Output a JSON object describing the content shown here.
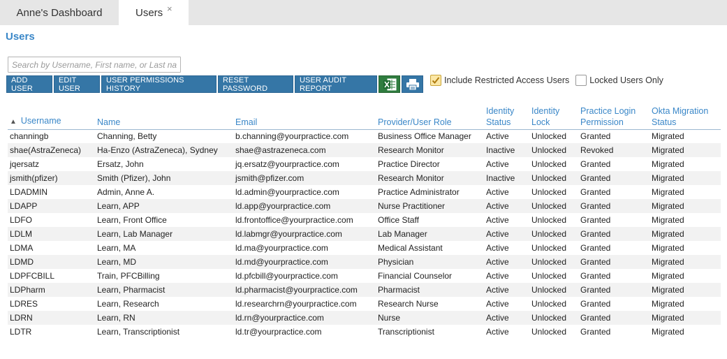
{
  "tabs": [
    {
      "label": "Anne's Dashboard"
    },
    {
      "label": "Users",
      "close": "×"
    }
  ],
  "page": {
    "title": "Users"
  },
  "search": {
    "placeholder": "Search by Username, First name, or Last name"
  },
  "toolbar": {
    "add_user": "ADD USER",
    "edit_user": "EDIT USER",
    "permissions_history": "USER PERMISSIONS HISTORY",
    "reset_password": "RESET PASSWORD",
    "audit_report": "USER AUDIT REPORT"
  },
  "filters": {
    "include_restricted": "Include Restricted Access Users",
    "locked_only": "Locked Users Only"
  },
  "table": {
    "headers": {
      "username": "Username",
      "name": "Name",
      "email": "Email",
      "role": "Provider/User Role",
      "identity_status": "Identity Status",
      "identity_lock": "Identity Lock",
      "login_permission": "Practice Login Permission",
      "okta_status": "Okta Migration Status"
    },
    "rows": [
      [
        "channingb",
        "Channing, Betty",
        "b.channing@yourpractice.com",
        "Business Office Manager",
        "Active",
        "Unlocked",
        "Granted",
        "Migrated"
      ],
      [
        "shae(AstraZeneca)",
        "Ha-Enzo (AstraZeneca), Sydney",
        "shae@astrazeneca.com",
        "Research Monitor",
        "Inactive",
        "Unlocked",
        "Revoked",
        "Migrated"
      ],
      [
        "jqersatz",
        "Ersatz, John",
        "jq.ersatz@yourpractice.com",
        "Practice Director",
        "Active",
        "Unlocked",
        "Granted",
        "Migrated"
      ],
      [
        "jsmith(pfizer)",
        "Smith (Pfizer), John",
        "jsmith@pfizer.com",
        "Research Monitor",
        "Inactive",
        "Unlocked",
        "Granted",
        "Migrated"
      ],
      [
        "LDADMIN",
        "Admin, Anne A.",
        "ld.admin@yourpractice.com",
        "Practice Administrator",
        "Active",
        "Unlocked",
        "Granted",
        "Migrated"
      ],
      [
        "LDAPP",
        "Learn, APP",
        "ld.app@yourpractice.com",
        "Nurse Practitioner",
        "Active",
        "Unlocked",
        "Granted",
        "Migrated"
      ],
      [
        "LDFO",
        "Learn, Front Office",
        "ld.frontoffice@yourpractice.com",
        "Office Staff",
        "Active",
        "Unlocked",
        "Granted",
        "Migrated"
      ],
      [
        "LDLM",
        "Learn, Lab Manager",
        "ld.labmgr@yourpractice.com",
        "Lab Manager",
        "Active",
        "Unlocked",
        "Granted",
        "Migrated"
      ],
      [
        "LDMA",
        "Learn, MA",
        "ld.ma@yourpractice.com",
        "Medical Assistant",
        "Active",
        "Unlocked",
        "Granted",
        "Migrated"
      ],
      [
        "LDMD",
        "Learn, MD",
        "ld.md@yourpractice.com",
        "Physician",
        "Active",
        "Unlocked",
        "Granted",
        "Migrated"
      ],
      [
        "LDPFCBILL",
        "Train, PFCBilling",
        "ld.pfcbill@yourpractice.com",
        "Financial Counselor",
        "Active",
        "Unlocked",
        "Granted",
        "Migrated"
      ],
      [
        "LDPharm",
        "Learn, Pharmacist",
        "ld.pharmacist@yourpractice.com",
        "Pharmacist",
        "Active",
        "Unlocked",
        "Granted",
        "Migrated"
      ],
      [
        "LDRES",
        "Learn, Research",
        "ld.researchrn@yourpractice.com",
        "Research Nurse",
        "Active",
        "Unlocked",
        "Granted",
        "Migrated"
      ],
      [
        "LDRN",
        "Learn, RN",
        "ld.rn@yourpractice.com",
        "Nurse",
        "Active",
        "Unlocked",
        "Granted",
        "Migrated"
      ],
      [
        "LDTR",
        "Learn, Transcriptionist",
        "ld.tr@yourpractice.com",
        "Transcriptionist",
        "Active",
        "Unlocked",
        "Granted",
        "Migrated"
      ]
    ]
  },
  "icons": {
    "excel": "excel-export-icon",
    "print": "printer-icon",
    "sort": "sort-ascending-icon",
    "check": "checkmark-icon"
  },
  "colors": {
    "accent": "#3a87c8",
    "button": "#3576a6",
    "excel": "#2f7c3f",
    "checkbox_checked": "#fbe7a6"
  }
}
